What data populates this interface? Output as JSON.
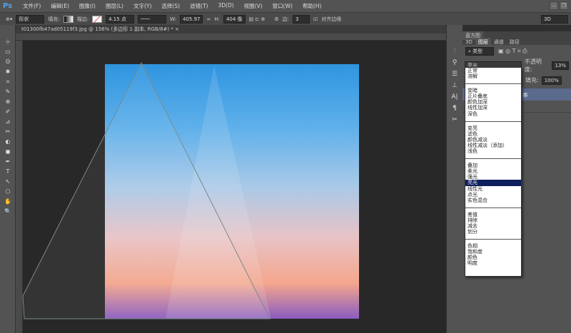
{
  "app": {
    "logo": "Ps"
  },
  "menu": [
    "文件(F)",
    "编辑(E)",
    "图像(I)",
    "图层(L)",
    "文字(Y)",
    "选择(S)",
    "滤镜(T)",
    "3D(D)",
    "视图(V)",
    "窗口(W)",
    "帮助(H)"
  ],
  "window_buttons": [
    "–",
    "❐"
  ],
  "options": {
    "mode": "形状",
    "fill_label": "填充:",
    "stroke_label": "描边:",
    "stroke_width": "4.15 点",
    "w_label": "W:",
    "w_value": "405.97",
    "h_label": "H:",
    "h_value": "404 像",
    "sides_label": "边:",
    "sides_value": "3",
    "align_edges": "对齐边缘",
    "workspace": "3D"
  },
  "document_tab": "t01300fb47ad05119f3.jpg @ 156% (多边形 1 副本, RGB/8#) * ×",
  "panel": {
    "header": "直方图",
    "tabs": [
      "3D",
      "图层",
      "通道",
      "路径"
    ],
    "filter": "类型",
    "blend_mode": "亮光",
    "opacity_label": "不透明度:",
    "opacity": "13%",
    "fill_label": "填充:",
    "fill": "100%",
    "layer_name": "本"
  },
  "blend_groups": [
    [
      "正常",
      "溶解"
    ],
    [
      "变暗",
      "正片叠底",
      "颜色加深",
      "线性加深",
      "深色"
    ],
    [
      "变亮",
      "滤色",
      "颜色减淡",
      "线性减淡（添加）",
      "浅色"
    ],
    [
      "叠加",
      "柔光",
      "强光",
      "亮光",
      "线性光",
      "点光",
      "实色混合"
    ],
    [
      "差值",
      "排除",
      "减去",
      "划分"
    ],
    [
      "色相",
      "饱和度",
      "颜色",
      "明度"
    ]
  ],
  "selected_blend": "亮光",
  "colors": {
    "selection": "#0e1e5e",
    "ui": "#535353"
  }
}
